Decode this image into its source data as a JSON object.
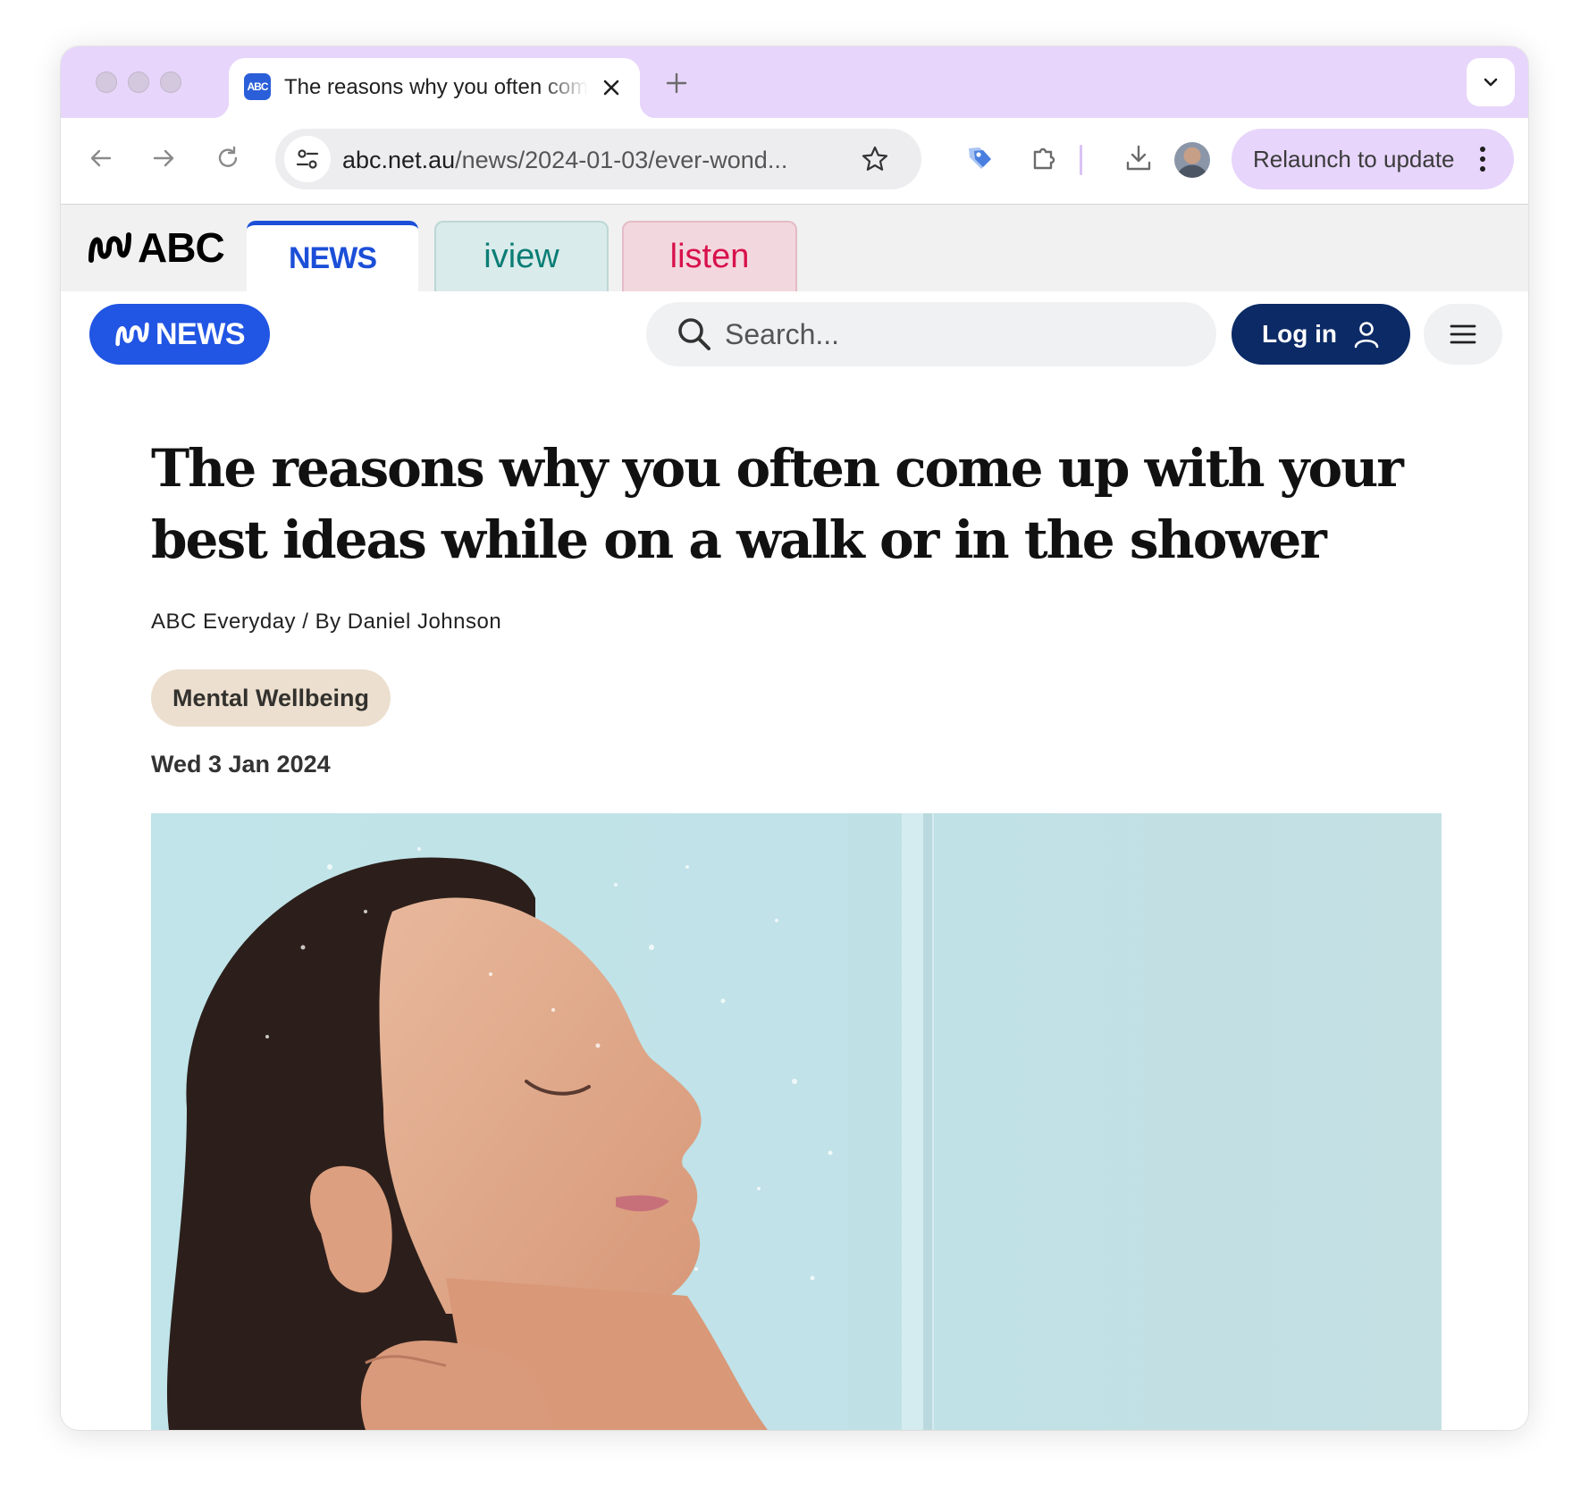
{
  "browser": {
    "tab": {
      "favicon": "ABC",
      "title": "The reasons why you often come up with your best ideas while on a walk or in the shower"
    },
    "url": {
      "host": "abc.net.au",
      "path": "/news/2024-01-03/ever-wond..."
    },
    "relaunch_label": "Relaunch to update"
  },
  "abc_network": {
    "logo_text": "ABC",
    "tabs": [
      {
        "label": "NEWS",
        "active": true
      },
      {
        "label": "iview",
        "active": false
      },
      {
        "label": "listen",
        "active": false
      }
    ]
  },
  "news_header": {
    "logo_text": "NEWS",
    "search_placeholder": "Search...",
    "login_label": "Log in"
  },
  "article": {
    "headline": "The reasons why you often come up with your best ideas while on a walk or in the shower",
    "byline": "ABC Everyday / By Daniel Johnson",
    "category": "Mental Wellbeing",
    "date": "Wed 3 Jan 2024",
    "hero_image": "woman-in-shower-photo"
  },
  "colors": {
    "tabstrip": "#e7d5fb",
    "abc_news_blue": "#2155e3",
    "login_navy": "#0b2a66",
    "iview_teal": "#0a7d75",
    "listen_pink": "#d8114b",
    "category_bg": "#ecdfcf"
  }
}
